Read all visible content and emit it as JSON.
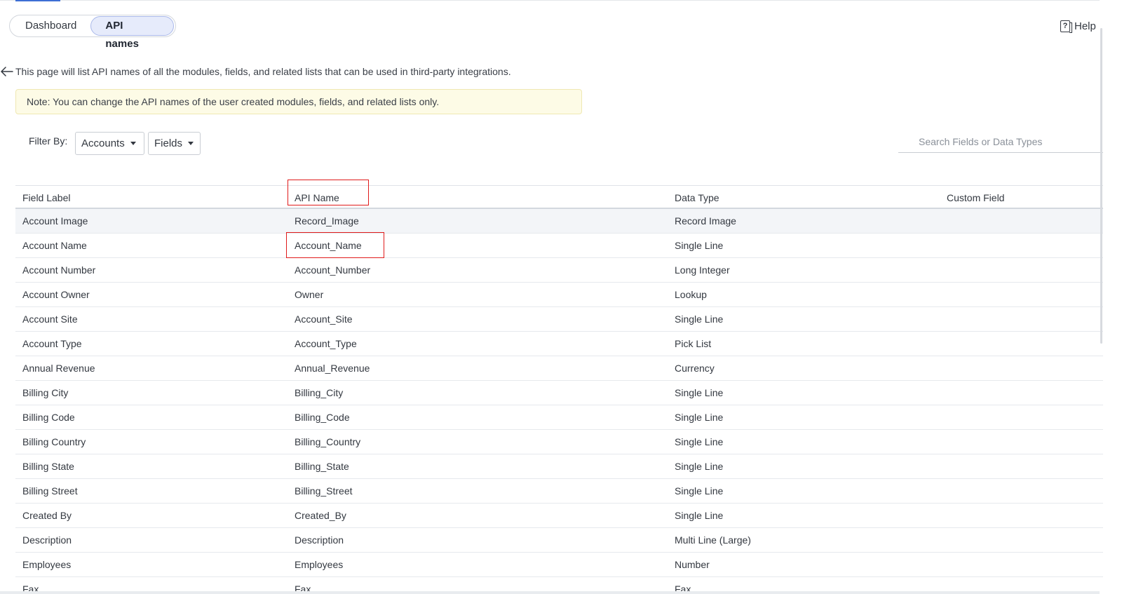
{
  "tabs": [
    {
      "label": "Dashboard",
      "active": false
    },
    {
      "label": "API names",
      "active": true
    }
  ],
  "help": {
    "label": "Help"
  },
  "intro_text": "This page will list API names of all the modules, fields, and related lists that can be used in third-party integrations.",
  "note_text": "Note: You can change the API names of the user created modules, fields, and related lists only.",
  "filter": {
    "label": "Filter By:",
    "module_selected": "Accounts",
    "type_selected": "Fields"
  },
  "search": {
    "placeholder": "Search Fields or Data Types",
    "value": ""
  },
  "table": {
    "headers": [
      "Field Label",
      "API Name",
      "Data Type",
      "Custom Field"
    ],
    "rows": [
      [
        "Account Image",
        "Record_Image",
        "Record Image",
        ""
      ],
      [
        "Account Name",
        "Account_Name",
        "Single Line",
        ""
      ],
      [
        "Account Number",
        "Account_Number",
        "Long Integer",
        ""
      ],
      [
        "Account Owner",
        "Owner",
        "Lookup",
        ""
      ],
      [
        "Account Site",
        "Account_Site",
        "Single Line",
        ""
      ],
      [
        "Account Type",
        "Account_Type",
        "Pick List",
        ""
      ],
      [
        "Annual Revenue",
        "Annual_Revenue",
        "Currency",
        ""
      ],
      [
        "Billing City",
        "Billing_City",
        "Single Line",
        ""
      ],
      [
        "Billing Code",
        "Billing_Code",
        "Single Line",
        ""
      ],
      [
        "Billing Country",
        "Billing_Country",
        "Single Line",
        ""
      ],
      [
        "Billing State",
        "Billing_State",
        "Single Line",
        ""
      ],
      [
        "Billing Street",
        "Billing_Street",
        "Single Line",
        ""
      ],
      [
        "Created By",
        "Created_By",
        "Single Line",
        ""
      ],
      [
        "Description",
        "Description",
        "Multi Line (Large)",
        ""
      ],
      [
        "Employees",
        "Employees",
        "Number",
        ""
      ],
      [
        "Fax",
        "Fax",
        "Fax",
        ""
      ]
    ]
  },
  "colors": {
    "accent": "#3d6fd4",
    "annotation_red": "#e01b1b",
    "note_bg": "#fdfbe6"
  }
}
